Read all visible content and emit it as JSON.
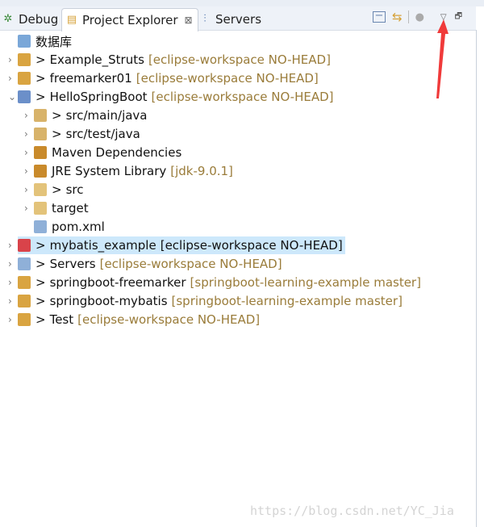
{
  "tabs": [
    {
      "label": "Debug",
      "icon": "bug-icon"
    },
    {
      "label": "Project Explorer",
      "icon": "project-explorer-icon",
      "close": "⊠"
    },
    {
      "label": "Servers",
      "icon": "servers-icon"
    }
  ],
  "tree": [
    {
      "label": "数据库",
      "level": 0,
      "expander": "",
      "prefix": "",
      "decoration": "",
      "icon": "folder",
      "color": "#7aa7d8"
    },
    {
      "label": "Example_Struts",
      "level": 0,
      "expander": "›",
      "prefix": ">",
      "decoration": "[eclipse-workspace NO-HEAD]",
      "color": "#d9a441"
    },
    {
      "label": "freemarker01",
      "level": 0,
      "expander": "›",
      "prefix": ">",
      "decoration": "[eclipse-workspace NO-HEAD]",
      "color": "#d9a441"
    },
    {
      "label": "HelloSpringBoot",
      "level": 0,
      "expander": "⌄",
      "prefix": ">",
      "decoration": "[eclipse-workspace NO-HEAD]",
      "color": "#6b8fc9"
    },
    {
      "label": "src/main/java",
      "level": 1,
      "expander": "›",
      "prefix": ">",
      "decoration": "",
      "color": "#d8b36a"
    },
    {
      "label": "src/test/java",
      "level": 1,
      "expander": "›",
      "prefix": ">",
      "decoration": "",
      "color": "#d8b36a"
    },
    {
      "label": "Maven Dependencies",
      "level": 1,
      "expander": "›",
      "prefix": "",
      "decoration": "",
      "color": "#c98a2b"
    },
    {
      "label": "JRE System Library",
      "level": 1,
      "expander": "›",
      "prefix": "",
      "decoration": "[jdk-9.0.1]",
      "color": "#c98a2b"
    },
    {
      "label": "src",
      "level": 1,
      "expander": "›",
      "prefix": ">",
      "decoration": "",
      "color": "#e3c37a"
    },
    {
      "label": "target",
      "level": 1,
      "expander": "›",
      "prefix": "",
      "decoration": "",
      "color": "#e3c37a"
    },
    {
      "label": "pom.xml",
      "level": 1,
      "expander": "",
      "prefix": "",
      "decoration": "",
      "color": "#8fb0d8"
    },
    {
      "label": "mybatis_example",
      "level": 0,
      "expander": "›",
      "prefix": ">",
      "decoration": "[eclipse-workspace NO-HEAD]",
      "color": "#d9434a",
      "selected": true
    },
    {
      "label": "Servers",
      "level": 0,
      "expander": "›",
      "prefix": ">",
      "decoration": "[eclipse-workspace NO-HEAD]",
      "color": "#8fb0d8"
    },
    {
      "label": "springboot-freemarker",
      "level": 0,
      "expander": "›",
      "prefix": ">",
      "decoration": "[springboot-learning-example master]",
      "color": "#d9a441"
    },
    {
      "label": "springboot-mybatis",
      "level": 0,
      "expander": "›",
      "prefix": ">",
      "decoration": "[springboot-learning-example master]",
      "color": "#d9a441"
    },
    {
      "label": "Test",
      "level": 0,
      "expander": "›",
      "prefix": ">",
      "decoration": "[eclipse-workspace NO-HEAD]",
      "color": "#d9a441"
    }
  ],
  "watermark": "https://blog.csdn.net/YC_Jia",
  "colors": {
    "accent_arrow": "#f03a3a",
    "selection": "#cde8fb",
    "decoration": "#9a7c3a"
  }
}
